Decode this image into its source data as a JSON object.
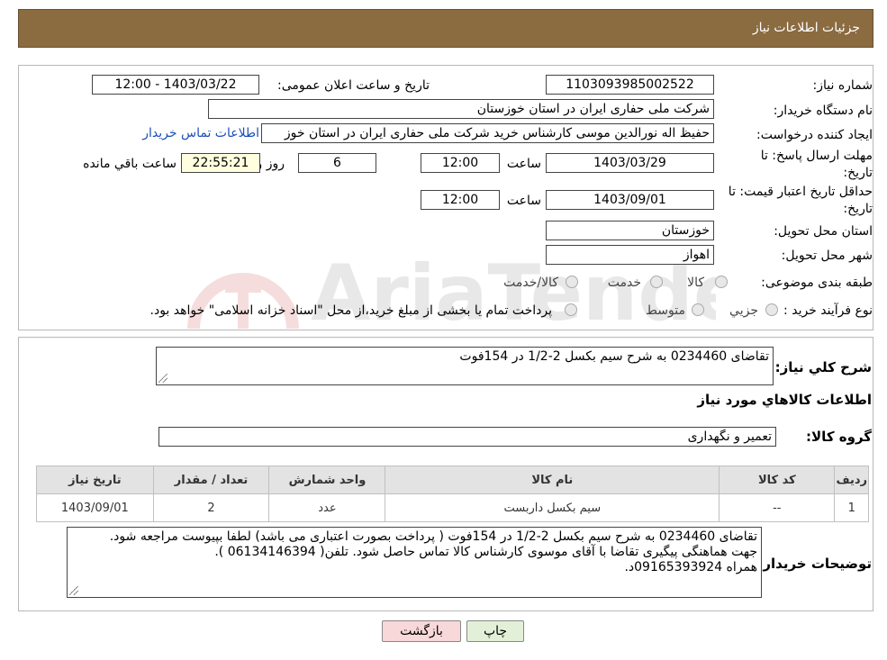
{
  "header": {
    "title": "جزئیات اطلاعات نیاز"
  },
  "form": {
    "need_number_label": "شماره نیاز:",
    "need_number": "1103093985002522",
    "announce_label": "تاریخ و ساعت اعلان عمومی:",
    "announce_value": "1403/03/22 - 12:00",
    "buyer_org_label": "نام دستگاه خریدار:",
    "buyer_org": "شرکت ملی حفاری ایران در استان خوزستان",
    "creator_label": "ایجاد کننده درخواست:",
    "creator": "حفیظ اله نورالدین موسی کارشناس خرید شرکت ملی حفاری ایران در استان خوز",
    "contact_link": "اطلاعات تماس خریدار",
    "deadline_label_1": "مهلت ارسال پاسخ: تا",
    "deadline_label_2": "تاریخ:",
    "deadline_date": "1403/03/29",
    "time_label": "ساعت",
    "deadline_time": "12:00",
    "days_value": "6",
    "days_label": "روز و",
    "remaining_time": "22:55:21",
    "remaining_label": "ساعت باقي مانده",
    "validity_label_1": "حداقل تاریخ اعتبار قیمت: تا",
    "validity_label_2": "تاریخ:",
    "validity_date": "1403/09/01",
    "validity_time_label": "ساعت",
    "validity_time": "12:00",
    "province_label": "استان محل تحویل:",
    "province": "خوزستان",
    "city_label": "شهر محل تحویل:",
    "city": "اهواز",
    "category_label": "طبقه بندی موضوعی:",
    "category_options": [
      "کالا",
      "خدمت",
      "کالا/خدمت"
    ],
    "process_label": "نوع فرآیند خرید :",
    "process_options": [
      "جزیي",
      "متوسط"
    ],
    "payment_note": "پرداخت تمام یا بخشی از مبلغ خرید،از محل \"اسناد خزانه اسلامی\" خواهد بود."
  },
  "details": {
    "summary_label": "شرح کلي نیاز:",
    "summary_text": "تقاضای 0234460 به شرح سیم بکسل 2-1/2 در 154فوت",
    "goods_info_title": "اطلاعات کالاهاي مورد نیاز",
    "group_label": "گروه کالا:",
    "group_value": "تعمیر و نگهداری",
    "table": {
      "headers": [
        "ردیف",
        "کد کالا",
        "نام کالا",
        "واحد شمارش",
        "تعداد / مقدار",
        "تاریخ نیاز"
      ],
      "rows": [
        [
          "1",
          "--",
          "سیم بکسل داربست",
          "عدد",
          "2",
          "1403/09/01"
        ]
      ]
    },
    "buyer_notes_label": "توضیحات خریدار:",
    "buyer_notes_lines": [
      "تقاضای 0234460 به شرح سیم بکسل 2-1/2 در 154فوت ( پرداخت بصورت اعتباری می باشد) لطفا بپیوست مراجعه شود.",
      "جهت هماهنگی پیگیری تقاضا با آقای موسوی کارشناس کالا تماس حاصل شود.  تلفن( 06134146394 ).",
      "همراه 09165393924د."
    ]
  },
  "buttons": {
    "print": "چاپ",
    "back": "بازگشت"
  },
  "watermark": {
    "text": "AriaTender.neT"
  },
  "colors": {
    "header_bg": "#8b6b40",
    "link": "#1a4fb8",
    "time_bg": "#ffffe0",
    "back_bg": "#f8d8d8",
    "print_bg": "#e2f0d8"
  }
}
